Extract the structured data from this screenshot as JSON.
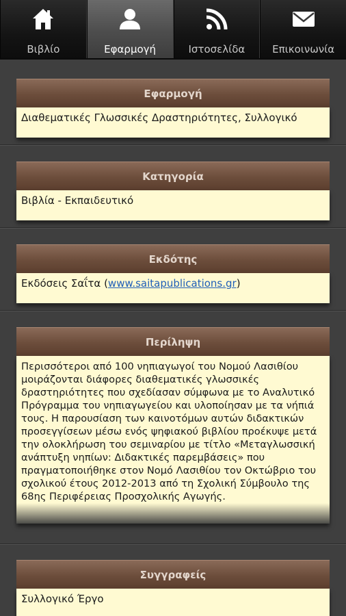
{
  "tabs": [
    {
      "label": "Βιβλίο",
      "icon": "home-icon"
    },
    {
      "label": "Εφαρμογή",
      "icon": "person-icon",
      "active": true
    },
    {
      "label": "Ιστοσελίδα",
      "icon": "rss-icon"
    },
    {
      "label": "Επικοινωνία",
      "icon": "mail-icon"
    }
  ],
  "sections": {
    "application": {
      "title": "Εφαρμογή",
      "value": "Διαθεματικές Γλωσσικές Δραστηριότητες, Συλλογικό"
    },
    "category": {
      "title": "Κατηγορία",
      "value": "Βιβλία - Εκπαιδευτικό"
    },
    "publisher": {
      "title": "Εκδότης",
      "name": "Εκδόσεις Σαΐτα",
      "open_paren": " (",
      "link": "www.saitapublications.gr",
      "close_paren": ")"
    },
    "summary": {
      "title": "Περίληψη",
      "text": "Περισσότεροι από 100 νηπιαγωγοί του Νομού Λασιθίου μοιράζονται διάφορες διαθεματικές γλωσσικές δραστηριότητες που σχεδίασαν σύμφωνα με το Αναλυτικό Πρόγραμμα του νηπιαγωγείου και υλοποίησαν με τα νήπιά τους. Η παρουσίαση των καινοτόμων αυτών διδακτικών προσεγγίσεων μέσω ενός ψηφιακού βιβλίου προέκυψε μετά την ολοκλήρωση του σεμιναρίου με τίτλο «Μεταγλωσσική ανάπτυξη νηπίων: Διδακτικές παρεμβάσεις» που πραγματοποιήθηκε στον Νομό Λασιθίου τον Οκτώβριο του σχολικού έτους 2012-2013 από τη Σχολική Σύμβουλο της 68ης Περιφέρειας Προσχολικής Αγωγής."
    },
    "authors": {
      "title": "Συγγραφείς",
      "value": "Συλλογικό Έργο"
    }
  }
}
